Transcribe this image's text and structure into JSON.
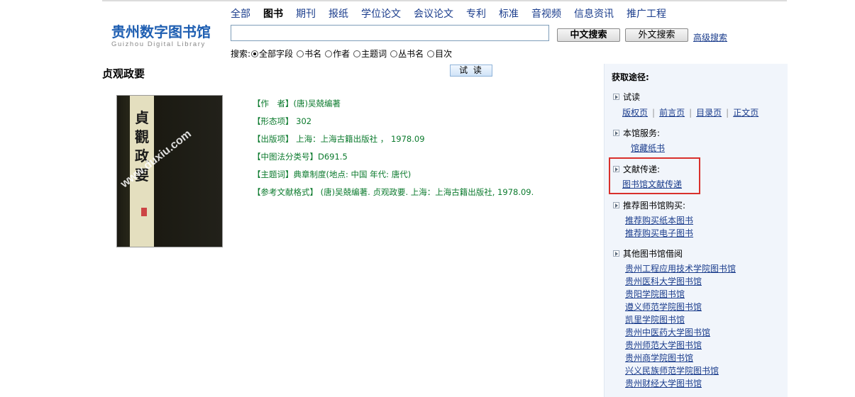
{
  "logo": {
    "cn": "贵州数字图书馆",
    "en": "Guizhou Digital Library"
  },
  "nav": {
    "items": [
      "全部",
      "图书",
      "期刊",
      "报纸",
      "学位论文",
      "会议论文",
      "专利",
      "标准",
      "音视频",
      "信息资讯",
      "推广工程"
    ],
    "active": "图书"
  },
  "search": {
    "value": "",
    "btn_cn": "中文搜索",
    "btn_en": "外文搜索",
    "advanced": "高级搜索",
    "field_label": "搜索:",
    "fields": [
      "全部字段",
      "书名",
      "作者",
      "主题词",
      "丛书名",
      "目次"
    ],
    "selected_field": "全部字段"
  },
  "book": {
    "title": "贞观政要",
    "try_read": "试 读",
    "cover": {
      "vertical_title": [
        "貞",
        "觀",
        "政",
        "要"
      ],
      "watermark": "www.duxiu.com"
    },
    "meta": [
      "【作　者】(唐)吴兢编著",
      "【形态项】 302",
      "【出版项】 上海：上海古籍出版社 ， 1978.09",
      "【中图法分类号】D691.5",
      "【主题词】典章制度(地点: 中国 年代: 唐代)",
      "【参考文献格式】 (唐)吴兢编著. 贞观政要. 上海：上海古籍出版社, 1978.09."
    ]
  },
  "panel": {
    "title": "获取途径:",
    "trial": {
      "label": "试读",
      "links": [
        "版权页",
        "前言页",
        "目录页",
        "正文页"
      ]
    },
    "service": {
      "label": "本馆服务:",
      "links": [
        "馆藏纸书"
      ]
    },
    "delivery": {
      "label": "文献传递:",
      "links": [
        "图书馆文献传递"
      ]
    },
    "purchase": {
      "label": "推荐图书馆购买:",
      "links": [
        "推荐购买纸本图书",
        "推荐购买电子图书"
      ]
    },
    "other": {
      "label": "其他图书馆借阅",
      "links": [
        "贵州工程应用技术学院图书馆",
        "贵州医科大学图书馆",
        "贵阳学院图书馆",
        "遵义师范学院图书馆",
        "凯里学院图书馆",
        "贵州中医药大学图书馆",
        "贵州师范大学图书馆",
        "贵州商学院图书馆",
        "兴义民族师范学院图书馆",
        "贵州财经大学图书馆"
      ]
    }
  },
  "colors": {
    "accent": "#1a3c8c",
    "meta_green": "#0b7a2d",
    "highlight": "#d9302c",
    "panel_bg": "#f1f5fb"
  }
}
